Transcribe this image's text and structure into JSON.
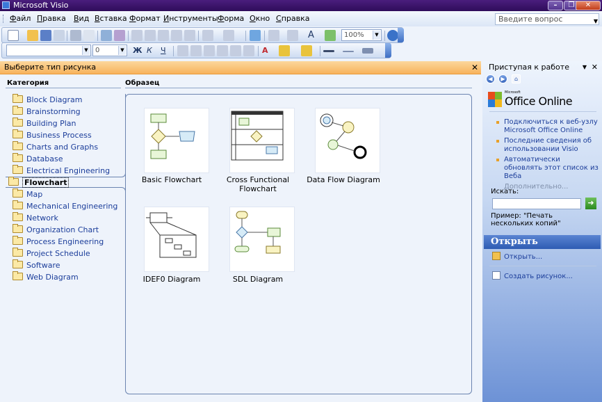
{
  "window": {
    "title": "Microsoft Visio"
  },
  "menu": [
    "Файл",
    "Правка",
    "Вид",
    "Вставка",
    "Формат",
    "Инструменты",
    "Форма",
    "Окно",
    "Справка"
  ],
  "help": {
    "placeholder": "Введите вопрос"
  },
  "toolbar": {
    "zoom": "100%",
    "font_size": "0",
    "bold": "Ж",
    "italic": "К",
    "underline": "Ч"
  },
  "gallery": {
    "header": "Выберите тип рисунка",
    "category_title": "Категория",
    "sample_title": "Образец",
    "categories": [
      "Block Diagram",
      "Brainstorming",
      "Building Plan",
      "Business Process",
      "Charts and Graphs",
      "Database",
      "Electrical Engineering",
      "Flowchart",
      "Map",
      "Mechanical Engineering",
      "Network",
      "Organization Chart",
      "Process Engineering",
      "Project Schedule",
      "Software",
      "Web Diagram"
    ],
    "selected_category": "Flowchart",
    "samples": [
      "Basic Flowchart",
      "Cross Functional Flowchart",
      "Data Flow Diagram",
      "IDEF0 Diagram",
      "SDL Diagram"
    ]
  },
  "task_pane": {
    "title": "Приступая к работе",
    "logo_small": "Microsoft",
    "logo": "Office Online",
    "links": [
      "Подключиться к веб-узлу Microsoft Office Online",
      "Последние сведения об использовании Visio",
      "Автоматически обновлять этот список из Веба"
    ],
    "more": "Дополнительно...",
    "search_label": "Искать:",
    "example": "Пример:  \"Печать нескольких копий\"",
    "open_header": "Открыть",
    "open_links": [
      "Открыть...",
      "Создать рисунок..."
    ]
  },
  "colors": {
    "pane_header": "#f7b35c",
    "link": "#1b3d9a",
    "title_bar": "#3b1068"
  }
}
